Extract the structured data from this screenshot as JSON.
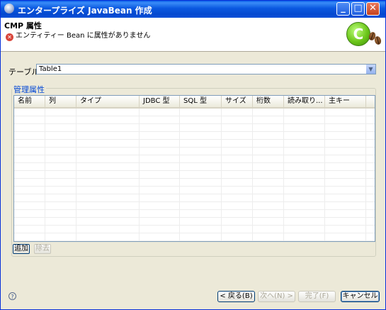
{
  "window": {
    "title": "エンタープライズ JavaBean 作成"
  },
  "title_buttons": {
    "minimize": "_",
    "maximize": "□",
    "close": "✕"
  },
  "header": {
    "title": "CMP 属性",
    "message": "エンティティー Bean に属性がありません",
    "error_glyph": "✕",
    "logo_letter": "C"
  },
  "form": {
    "table_label": "テーブル :",
    "table_value": "Table1",
    "arrow_glyph": "▼"
  },
  "group": {
    "label": "管理属性",
    "columns": [
      "名前",
      "列",
      "タイプ",
      "JDBC 型",
      "SQL 型",
      "サイズ",
      "桁数",
      "読み取り...",
      "主キー"
    ],
    "add_button": "追加",
    "remove_button": "除去"
  },
  "footer": {
    "help_glyph": "?",
    "back_button": "< 戻る(B)",
    "next_button": "次へ(N) >",
    "finish_button": "完了(F)",
    "cancel_button": "キャンセル"
  },
  "colors": {
    "accent": "#0046d5",
    "titlebar": "#0a58e0",
    "error": "#d9453a"
  }
}
